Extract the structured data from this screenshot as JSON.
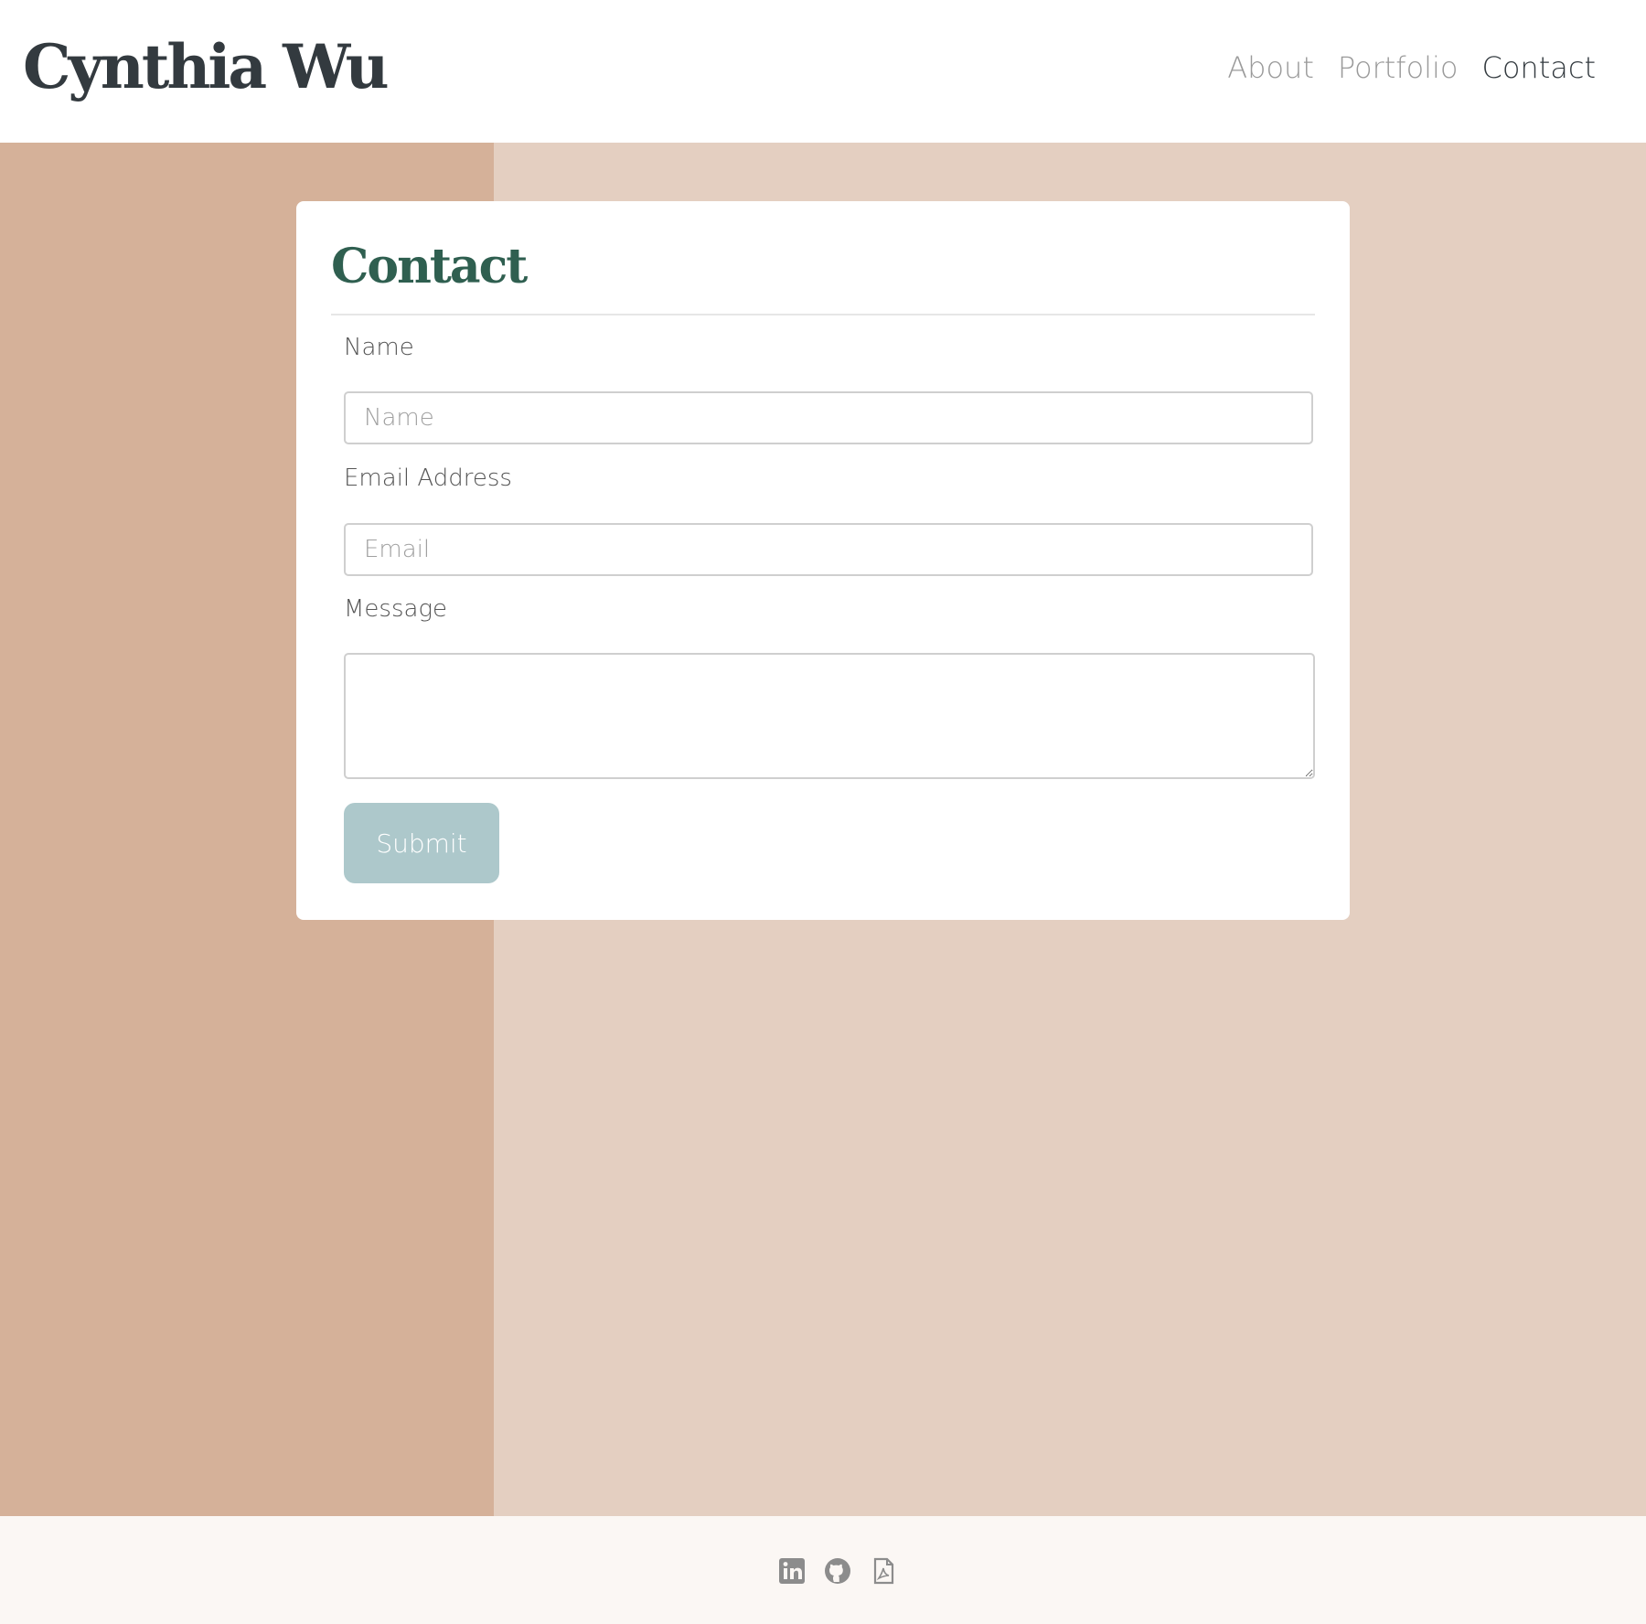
{
  "header": {
    "brand": "Cynthia Wu",
    "nav": [
      {
        "label": "About",
        "active": false
      },
      {
        "label": "Portfolio",
        "active": false
      },
      {
        "label": "Contact",
        "active": true
      }
    ]
  },
  "contact_form": {
    "title": "Contact",
    "name": {
      "label": "Name",
      "placeholder": "Name",
      "value": ""
    },
    "email": {
      "label": "Email Address",
      "placeholder": "Email",
      "value": ""
    },
    "message": {
      "label": "Message",
      "value": ""
    },
    "submit_label": "Submit"
  },
  "footer": {
    "icons": [
      "linkedin-icon",
      "github-icon",
      "pdf-icon"
    ]
  },
  "colors": {
    "brand_text": "#333a3f",
    "title_green": "#2f5f50",
    "bg_left": "#d5b199",
    "bg_right": "#e4cfc1",
    "submit_bg": "#adc8cb",
    "footer_bg": "#fbf7f4",
    "icon_gray": "#8c8c8c"
  }
}
